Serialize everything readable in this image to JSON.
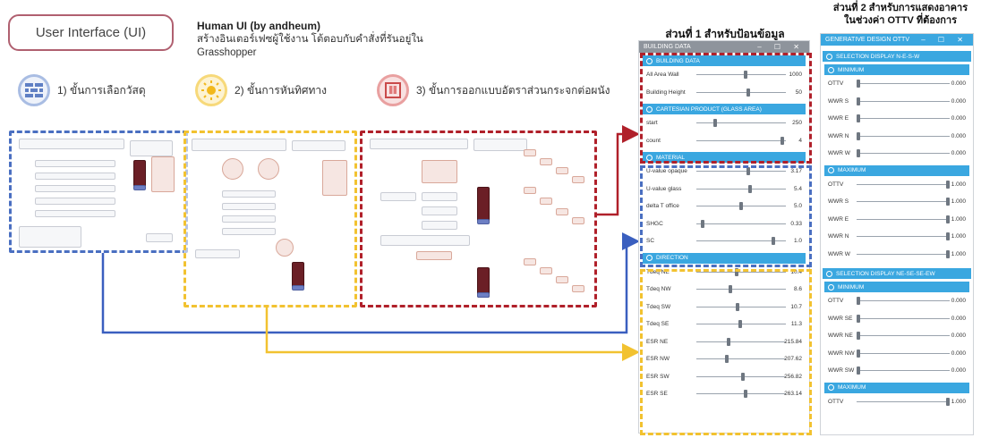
{
  "header": {
    "ui_label": "User Interface (UI)",
    "human_title": "Human UI (by andheum)",
    "human_desc": "สร้างอินเตอร์เฟซผู้ใช้งาน โต้ตอบกับคำสั่งที่รันอยู่ใน Grasshopper"
  },
  "steps": [
    {
      "label": "1) ขั้นการเลือกวัสดุ",
      "color": "#7d9bd0",
      "icon": "brick-wall-icon"
    },
    {
      "label": "2) ขั้นการหันทิศทาง",
      "color": "#f2c230",
      "icon": "sun-icon"
    },
    {
      "label": "3) ขั้นการออกแบบอัตราส่วนกระจกต่อผนัง",
      "color": "#d45c5c",
      "icon": "window-wall-icon"
    }
  ],
  "colors": {
    "blue": "#4a6fc1",
    "yellow": "#f2c230",
    "red": "#b0202a",
    "arrow_red": "#b0202a",
    "arrow_blue": "#3a5fbf",
    "arrow_yellow": "#f2c230",
    "accent": "#3aa7e0"
  },
  "input_panel": {
    "section_title": "ส่วนที่ 1 สำหรับป้อนข้อมูล",
    "window_title": "BUILDING DATA",
    "groups": [
      {
        "title": "BUILDING DATA",
        "rows": [
          {
            "label": "All Area Wall",
            "value": "1000",
            "pos": 0.55
          },
          {
            "label": "Building Height",
            "value": "50",
            "pos": 0.58
          }
        ]
      },
      {
        "title": "CARTESIAN PRODUCT (GLASS AREA)",
        "rows": [
          {
            "label": "start",
            "value": "250",
            "pos": 0.2
          },
          {
            "label": "count",
            "value": "4",
            "pos": 0.98
          }
        ]
      },
      {
        "title": "MATERIAL",
        "rows": [
          {
            "label": "U-value opaque",
            "value": "3.17",
            "pos": 0.58
          },
          {
            "label": "U-value glass",
            "value": "5.4",
            "pos": 0.6
          },
          {
            "label": "delta T office",
            "value": "5.0",
            "pos": 0.5
          },
          {
            "label": "SHGC",
            "value": "0.33",
            "pos": 0.05
          },
          {
            "label": "SC",
            "value": "1.0",
            "pos": 0.88
          }
        ]
      },
      {
        "title": "DIRECTION",
        "rows": [
          {
            "label": "Tdeq NE",
            "value": "10.4",
            "pos": 0.45
          },
          {
            "label": "Tdeq NW",
            "value": "8.6",
            "pos": 0.38
          },
          {
            "label": "Tdeq SW",
            "value": "10.7",
            "pos": 0.46
          },
          {
            "label": "Tdeq SE",
            "value": "11.3",
            "pos": 0.49
          },
          {
            "label": "ESR NE",
            "value": "215.84",
            "pos": 0.35
          },
          {
            "label": "ESR NW",
            "value": "207.62",
            "pos": 0.33
          },
          {
            "label": "ESR SW",
            "value": "256.82",
            "pos": 0.52
          },
          {
            "label": "ESR SE",
            "value": "263.14",
            "pos": 0.55
          }
        ]
      }
    ]
  },
  "output_panel": {
    "section_title_1": "ส่วนที่ 2 สำหรับการแสดงอาคาร",
    "section_title_2": "ในช่วงค่า OTTV ที่ต้องการ",
    "window_title": "GENERATIVE DESIGN OTTV",
    "groups": [
      {
        "title": "SELECTION DISPLAY N-E-S-W",
        "kind": "section"
      },
      {
        "title": "MINIMUM",
        "rows": [
          {
            "label": "OTTV",
            "value": "0.000",
            "pos": 0.0
          },
          {
            "label": "WWR S",
            "value": "0.000",
            "pos": 0.0
          },
          {
            "label": "WWR E",
            "value": "0.000",
            "pos": 0.0
          },
          {
            "label": "WWR N",
            "value": "0.000",
            "pos": 0.0
          },
          {
            "label": "WWR W",
            "value": "0.000",
            "pos": 0.0
          }
        ]
      },
      {
        "title": "MAXIMUM",
        "rows": [
          {
            "label": "OTTV",
            "value": "1.000",
            "pos": 1.0
          },
          {
            "label": "WWR S",
            "value": "1.000",
            "pos": 1.0
          },
          {
            "label": "WWR E",
            "value": "1.000",
            "pos": 1.0
          },
          {
            "label": "WWR N",
            "value": "1.000",
            "pos": 1.0
          },
          {
            "label": "WWR W",
            "value": "1.000",
            "pos": 1.0
          }
        ]
      },
      {
        "title": "SELECTION DISPLAY NE-SE-SE-EW",
        "kind": "section"
      },
      {
        "title": "MINIMUM",
        "rows": [
          {
            "label": "OTTV",
            "value": "0.000",
            "pos": 0.0
          },
          {
            "label": "WWR SE",
            "value": "0.000",
            "pos": 0.0
          },
          {
            "label": "WWR NE",
            "value": "0.000",
            "pos": 0.0
          },
          {
            "label": "WWR NW",
            "value": "0.000",
            "pos": 0.0
          },
          {
            "label": "WWR SW",
            "value": "0.000",
            "pos": 0.0
          }
        ]
      },
      {
        "title": "MAXIMUM",
        "rows": [
          {
            "label": "OTTV",
            "value": "1.000",
            "pos": 1.0
          }
        ]
      }
    ]
  }
}
